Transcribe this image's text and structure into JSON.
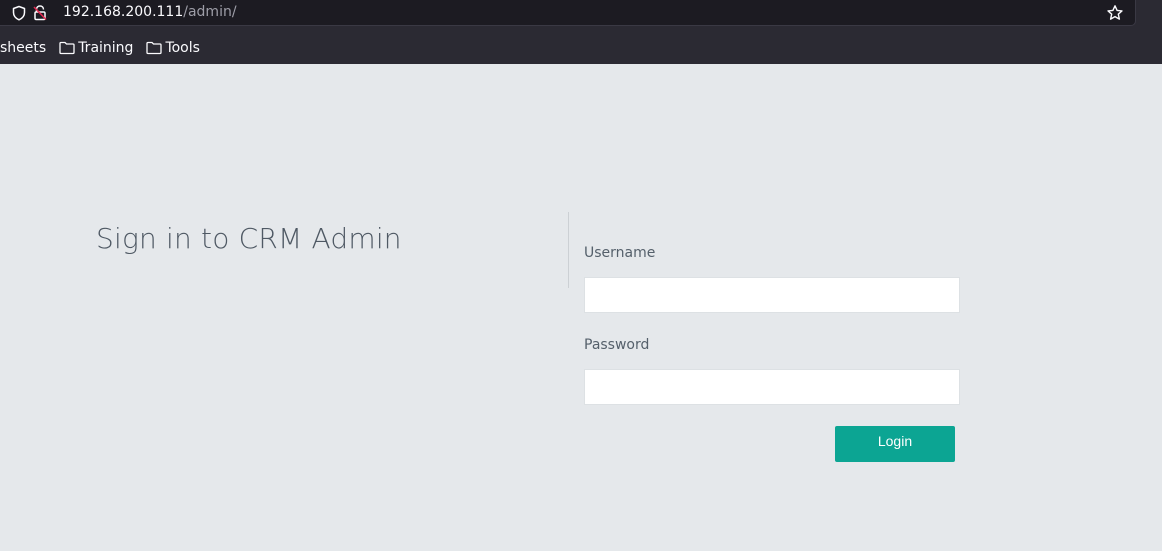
{
  "browser": {
    "url_host": "192.168.200.111",
    "url_path": "/admin/",
    "bookmarks": [
      {
        "label": "sheets"
      },
      {
        "label": "Training",
        "icon": "folder-icon"
      },
      {
        "label": "Tools",
        "icon": "folder-icon"
      }
    ]
  },
  "login": {
    "title": "Sign in to CRM Admin",
    "username_label": "Username",
    "username_value": "",
    "password_label": "Password",
    "password_value": "",
    "submit_label": "Login"
  },
  "colors": {
    "page_background": "#e5e8eb",
    "accent": "#0ca593",
    "chrome": "#2b2a33"
  }
}
